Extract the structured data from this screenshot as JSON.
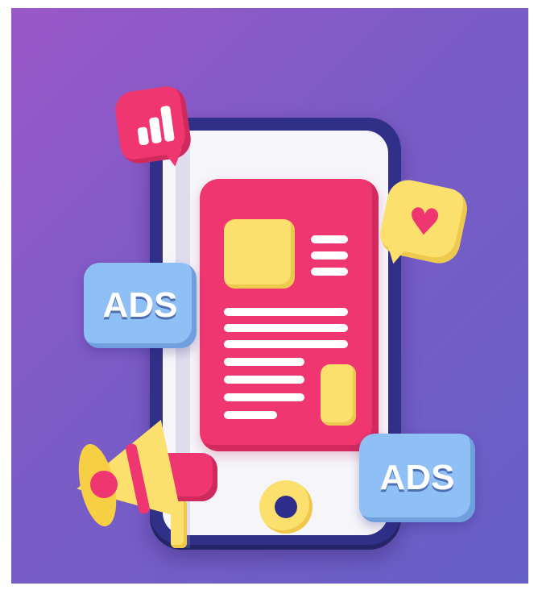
{
  "badges": [
    {
      "label": "ADS"
    },
    {
      "label": "ADS"
    }
  ],
  "icons": [
    "bar-chart-icon",
    "heart-icon",
    "megaphone-icon"
  ],
  "colors": {
    "background": "#7a5cc6",
    "phone_frame": "#303088",
    "card": "#f03670",
    "yellow": "#fbe06d",
    "badge_blue": "#8fc0f5"
  }
}
